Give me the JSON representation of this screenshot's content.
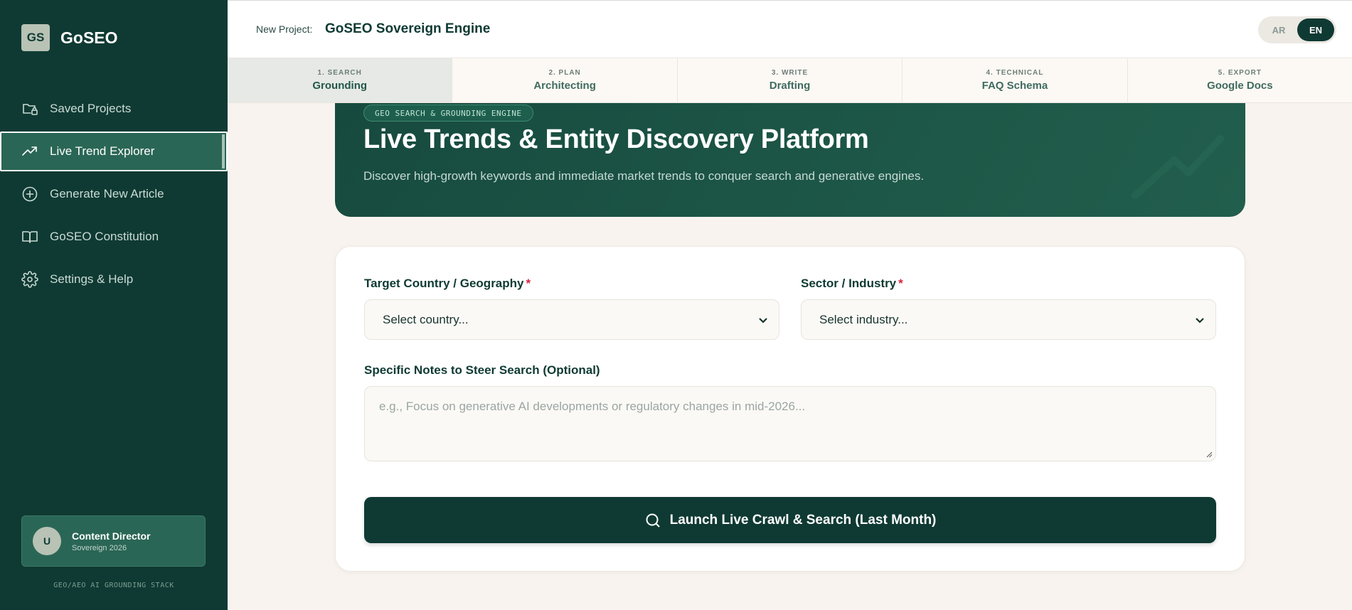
{
  "brand": {
    "logo": "GS",
    "name": "GoSEO"
  },
  "sidebar": {
    "items": [
      {
        "label": "Saved Projects",
        "icon": "folder-lock-icon",
        "active": false
      },
      {
        "label": "Live Trend Explorer",
        "icon": "trend-up-icon",
        "active": true
      },
      {
        "label": "Generate New Article",
        "icon": "plus-circle-icon",
        "active": false
      },
      {
        "label": "GoSEO Constitution",
        "icon": "book-icon",
        "active": false
      },
      {
        "label": "Settings & Help",
        "icon": "gear-icon",
        "active": false
      }
    ],
    "user": {
      "initial": "U",
      "name": "Content Director",
      "subtitle": "Sovereign 2026"
    },
    "stack_label": "GEO/AEO AI GROUNDING STACK"
  },
  "header": {
    "project_label": "New Project:",
    "project_name": "GoSEO Sovereign Engine",
    "languages": [
      {
        "code": "AR",
        "active": false
      },
      {
        "code": "EN",
        "active": true
      }
    ]
  },
  "steps": [
    {
      "num": "1. SEARCH",
      "name": "Grounding",
      "active": true
    },
    {
      "num": "2. PLAN",
      "name": "Architecting",
      "active": false
    },
    {
      "num": "3. WRITE",
      "name": "Drafting",
      "active": false
    },
    {
      "num": "4. TECHNICAL",
      "name": "FAQ Schema",
      "active": false
    },
    {
      "num": "5. EXPORT",
      "name": "Google Docs",
      "active": false
    }
  ],
  "hero": {
    "badge": "GEO SEARCH & GROUNDING ENGINE",
    "title": "Live Trends & Entity Discovery Platform",
    "subtitle": "Discover high-growth keywords and immediate market trends to conquer search and generative engines."
  },
  "form": {
    "country_label": "Target Country / Geography",
    "country_placeholder": "Select country...",
    "industry_label": "Sector / Industry",
    "industry_placeholder": "Select industry...",
    "required_mark": "*",
    "notes_label": "Specific Notes to Steer Search (Optional)",
    "notes_placeholder": "e.g., Focus on generative AI developments or regulatory changes in mid-2026...",
    "submit_label": "Launch Live Crawl & Search (Last Month)"
  },
  "colors": {
    "sidebar_bg": "#0f3a33",
    "accent": "#2a6655",
    "required": "#d6243c",
    "page_bg": "#f8f3ee"
  }
}
